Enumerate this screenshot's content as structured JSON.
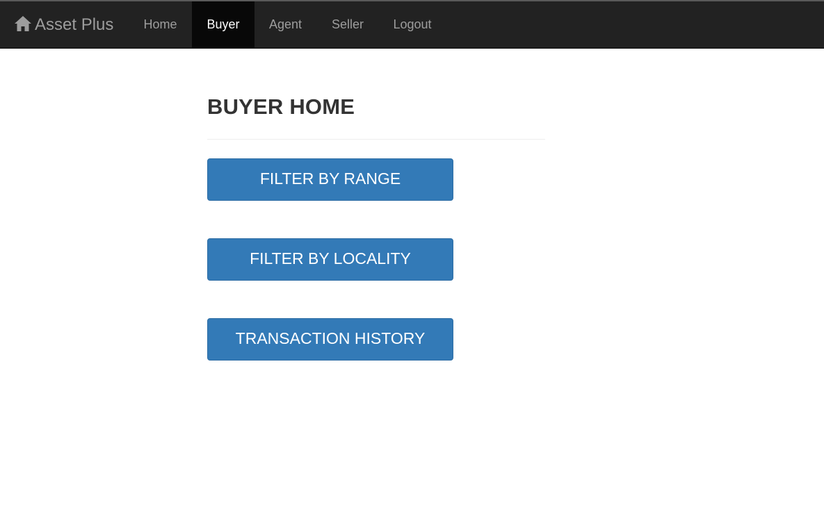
{
  "navbar": {
    "brand": "Asset Plus",
    "brand_icon": "home-icon",
    "items": [
      {
        "label": "Home",
        "active": false
      },
      {
        "label": "Buyer",
        "active": true
      },
      {
        "label": "Agent",
        "active": false
      },
      {
        "label": "Seller",
        "active": false
      },
      {
        "label": "Logout",
        "active": false
      }
    ]
  },
  "main": {
    "title": "BUYER HOME",
    "buttons": [
      {
        "label": "FILTER BY RANGE"
      },
      {
        "label": "FILTER BY LOCALITY"
      },
      {
        "label": "TRANSACTION HISTORY"
      }
    ]
  },
  "colors": {
    "navbar_bg": "#222222",
    "nav_active_bg": "#080808",
    "nav_text": "#9d9d9d",
    "button_primary": "#337ab7",
    "title_text": "#333333"
  }
}
